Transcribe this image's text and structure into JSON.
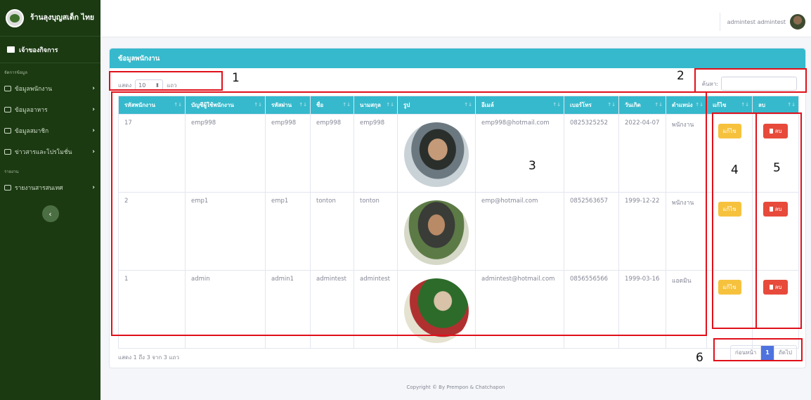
{
  "sidebar": {
    "brand": "ร้านลุงบุญสเต็ก ไทย",
    "top_item": "เจ้าของกิจการ",
    "section_manage": "จัดการข้อมูล",
    "items": [
      {
        "label": "ข้อมูลพนักงาน"
      },
      {
        "label": "ข้อมูลอาหาร"
      },
      {
        "label": "ข้อมูลสมาชิก"
      },
      {
        "label": "ข่าวสารและโปรโมชั่น"
      }
    ],
    "section_report": "รายงาน",
    "report_items": [
      {
        "label": "รายงานสารสนเทศ"
      }
    ],
    "collapse": "‹",
    "chevron": "›"
  },
  "topbar": {
    "user_name": "admintest admintest"
  },
  "card": {
    "title": "ข้อมูลพนักงาน",
    "length_prefix": "แสดง",
    "length_value": "10",
    "length_suffix": "แถว",
    "search_label": "ค้นหา:",
    "search_value": "",
    "columns": [
      "รหัสพนักงาน",
      "บัญชีผู้ใช้พนักงาน",
      "รหัสผ่าน",
      "ชื่อ",
      "นามสกุล",
      "รูป",
      "อีเมล์",
      "เบอร์โทร",
      "วันเกิด",
      "ตำแหน่ง",
      "แก้ไข",
      "ลบ"
    ],
    "rows": [
      {
        "id": "17",
        "username": "emp998",
        "password": "emp998",
        "first": "emp998",
        "last": "emp998",
        "email": "emp998@hotmail.com",
        "phone": "0825325252",
        "birth": "2022-04-07",
        "position": "พนักงาน"
      },
      {
        "id": "2",
        "username": "emp1",
        "password": "emp1",
        "first": "tonton",
        "last": "tonton",
        "email": "emp@hotmail.com",
        "phone": "0852563657",
        "birth": "1999-12-22",
        "position": "พนักงาน"
      },
      {
        "id": "1",
        "username": "admin",
        "password": "admin1",
        "first": "admintest",
        "last": "admintest",
        "email": "admintest@hotmail.com",
        "phone": "0856556566",
        "birth": "1999-03-16",
        "position": "แอดมิน"
      }
    ],
    "edit_label": "แก้ไข",
    "delete_label": "ลบ",
    "info": "แสดง 1 ถึง 3 จาก 3 แถว",
    "pager": {
      "prev": "ก่อนหน้า",
      "current": "1",
      "next": "ถัดไป"
    }
  },
  "footer": "Copyright © By Prempon & Chatchapon",
  "annotations": [
    "1",
    "2",
    "3",
    "4",
    "5",
    "6"
  ],
  "colors": {
    "sidebar": "#1b3a12",
    "accent": "#36b9cc",
    "edit": "#f6c23e",
    "delete": "#e74a3b",
    "marker": "#e0101a"
  }
}
